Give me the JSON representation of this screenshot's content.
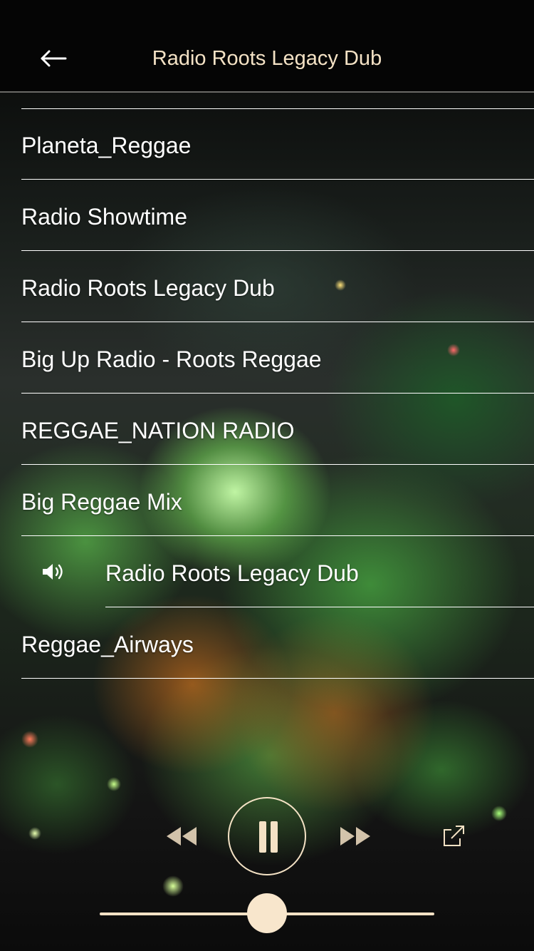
{
  "header": {
    "title": "Radio Roots Legacy Dub"
  },
  "stations": [
    {
      "label": "Planeta_Reggae",
      "playing": false
    },
    {
      "label": "Radio Showtime",
      "playing": false
    },
    {
      "label": "Radio Roots Legacy Dub",
      "playing": false
    },
    {
      "label": "Big Up Radio - Roots Reggae",
      "playing": false
    },
    {
      "label": "REGGAE_NATION RADIO",
      "playing": false
    },
    {
      "label": "Big Reggae Mix",
      "playing": false
    },
    {
      "label": "Radio Roots Legacy Dub",
      "playing": true
    },
    {
      "label": "Reggae_Airways",
      "playing": false
    }
  ],
  "player": {
    "state": "playing",
    "volume_fraction": 0.5
  },
  "colors": {
    "accent": "#f4e2c5",
    "text": "#ffffff",
    "header_bg": "#050505"
  },
  "icons": {
    "back": "arrow-left-icon",
    "speaker": "speaker-icon",
    "rewind": "rewind-icon",
    "pause": "pause-icon",
    "forward": "fast-forward-icon",
    "share": "share-icon"
  }
}
